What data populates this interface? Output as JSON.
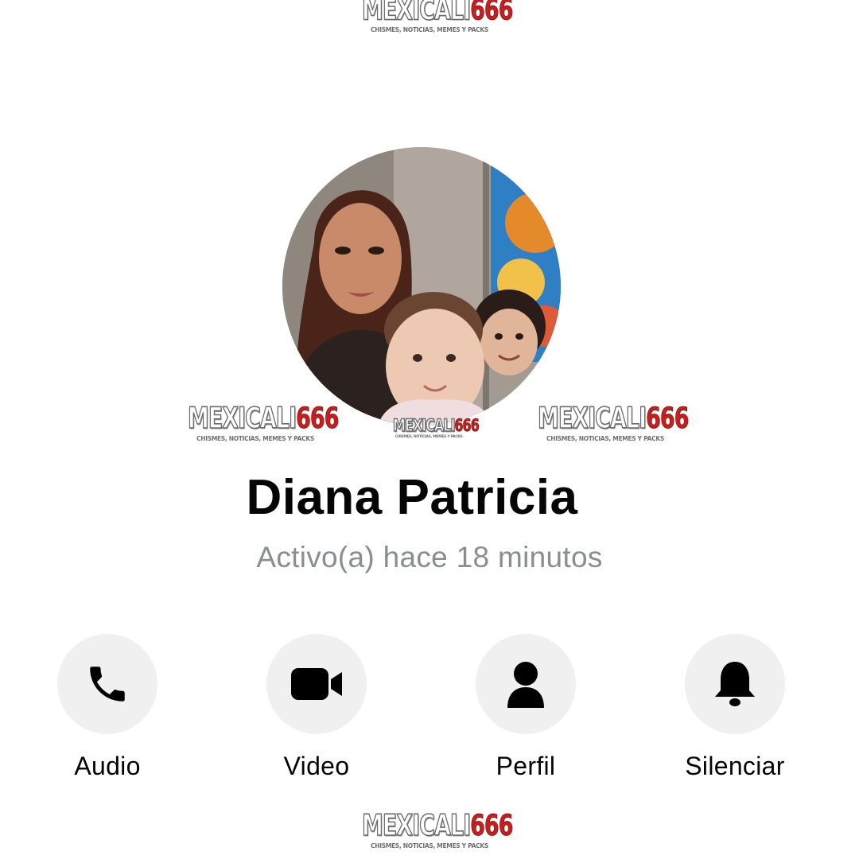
{
  "contact": {
    "name": "Diana Patricia",
    "status": "Activo(a) hace 18 minutos"
  },
  "actions": [
    {
      "label": "Audio",
      "icon": "phone-icon"
    },
    {
      "label": "Video",
      "icon": "video-camera-icon"
    },
    {
      "label": "Perfil",
      "icon": "profile-icon"
    },
    {
      "label": "Silenciar",
      "icon": "bell-icon"
    }
  ],
  "watermark": {
    "name_word": "MEXICALI",
    "name_number": "666",
    "tagline": "CHISMES, NOTICIAS, MEMES Y PACKS"
  },
  "colors": {
    "text_primary": "#050505",
    "text_secondary": "#8a8d91",
    "button_background": "#f0f0f0",
    "icon": "#000000",
    "watermark_red": "#c81e1e"
  }
}
